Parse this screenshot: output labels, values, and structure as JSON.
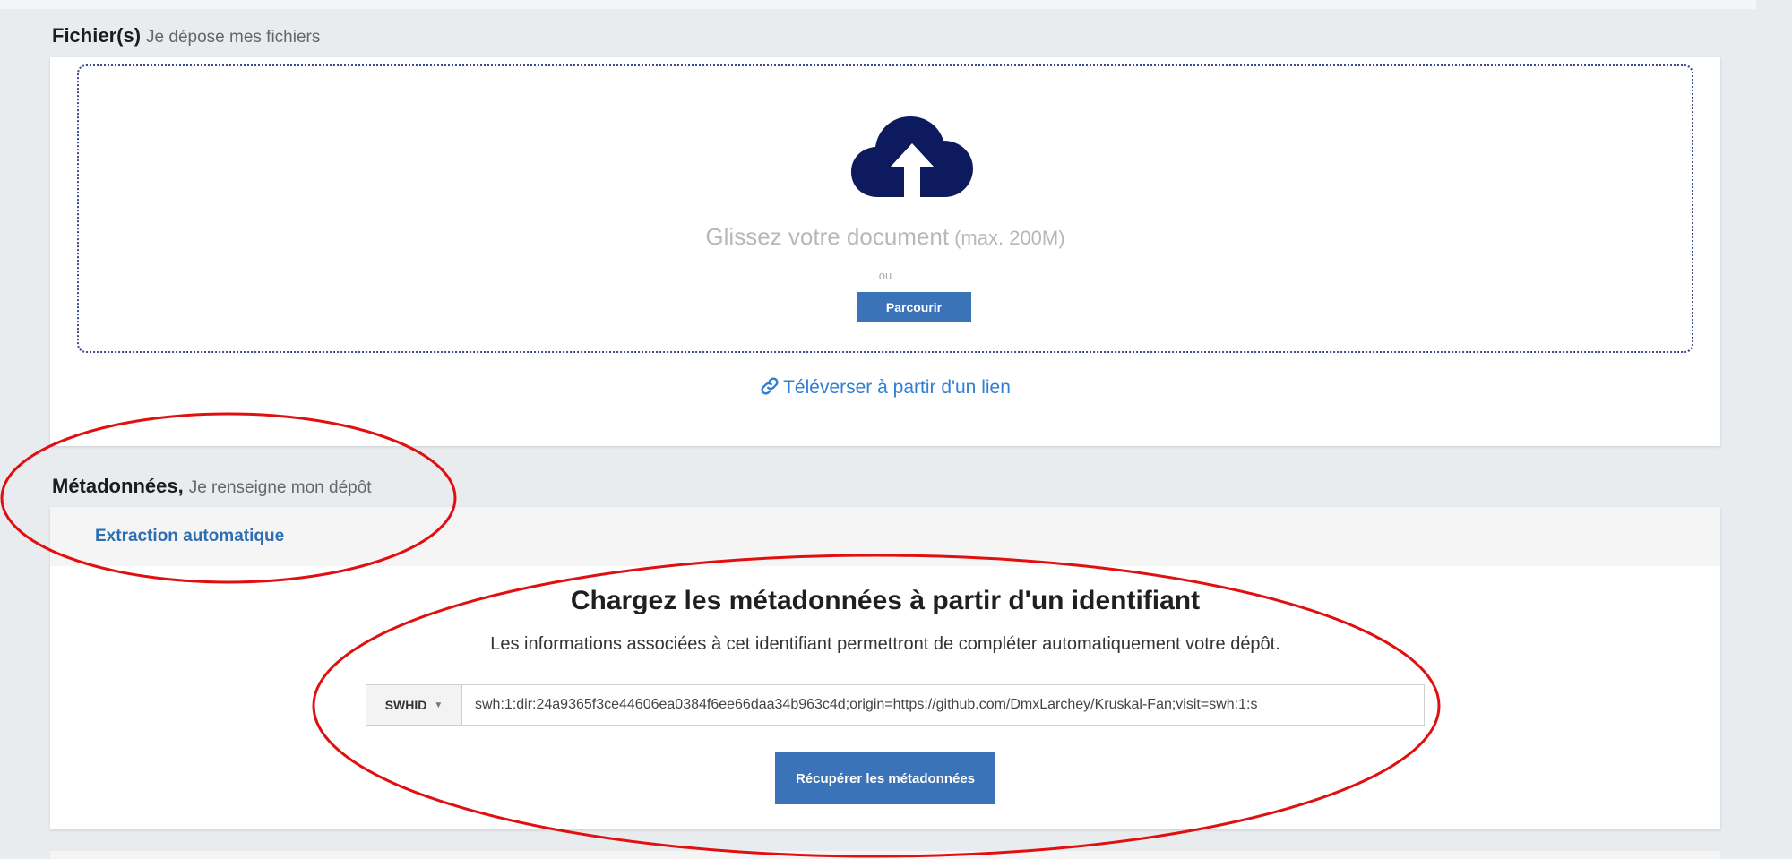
{
  "files": {
    "title": "Fichier(s)",
    "subtitle": "Je dépose mes fichiers",
    "drop_text": "Glissez votre document",
    "drop_max": "(max. 200M)",
    "or_text": "ou",
    "browse_label": "Parcourir",
    "link_upload_label": "Téléverser à partir d'un lien",
    "cloud_icon": "cloud-upload-icon"
  },
  "metadata": {
    "title": "Métadonnées,",
    "subtitle": "Je renseigne mon dépôt",
    "tab_label": "Extraction automatique",
    "heading": "Chargez les métadonnées à partir d'un identifiant",
    "description": "Les informations associées à cet identifiant permettront de compléter automatiquement votre dépôt.",
    "identifier_type": "SWHID",
    "identifier_value": "swh:1:dir:24a9365f3ce44606ea0384f6ee66daa34b963c4d;origin=https://github.com/DmxLarchey/Kruskal-Fan;visit=swh:1:s",
    "fetch_label": "Récupérer les métadonnées"
  },
  "colors": {
    "accent": "#3a73b8",
    "link": "#2f7fd2",
    "cloud": "#0d1b5e",
    "annotation": "#e01010"
  }
}
